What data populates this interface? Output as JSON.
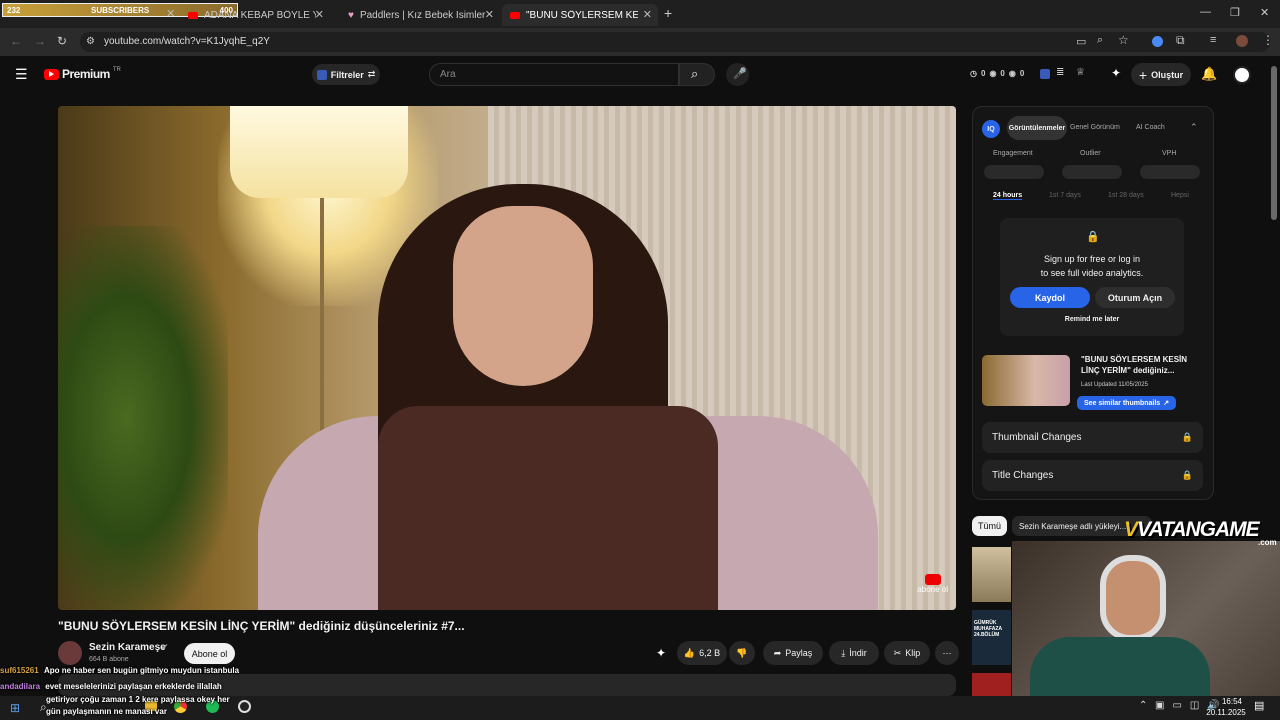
{
  "overlay": {
    "count": "232",
    "label": "SUBSCRIBERS",
    "count2": "400"
  },
  "tabs": [
    {
      "label": "ADANA KEBAP BÖYLE YAPILIR (",
      "active": false
    },
    {
      "label": "Paddlers | Kız Bebek İsimleri: A",
      "active": false
    },
    {
      "label": "\"BUNU SÖYLERSEM KESİN LİNÇ",
      "active": true
    }
  ],
  "browser": {
    "url": "youtube.com/watch?v=K1JyqhE_q2Y"
  },
  "youtube": {
    "brand": "Premium",
    "region": "TR",
    "filters": "Filtreler",
    "search_placeholder": "Ara",
    "create": "Oluştur",
    "counts": [
      "0",
      "0",
      "0"
    ]
  },
  "video": {
    "title": "\"BUNU SÖYLERSEM KESİN LİNÇ YERİM\" dediğiniz düşünceleriniz #7...",
    "channel": "Sezin Karameşe",
    "subs": "664 B abone",
    "subscribe": "Abone ol",
    "likes": "6,2 B",
    "share": "Paylaş",
    "download": "İndir",
    "clip": "Klip",
    "watermark": "abone ol"
  },
  "panel": {
    "tabs": [
      "Görüntülenmeler",
      "Genel Görünüm",
      "AI Coach"
    ],
    "metrics": [
      "Engagement",
      "Outlier",
      "VPH"
    ],
    "ranges": [
      "24 hours",
      "1st 7 days",
      "1st 28 days",
      "Hepsi"
    ],
    "lock_line1": "Sign up for free or log in",
    "lock_line2": "to see full video analytics.",
    "signup": "Kaydol",
    "login": "Oturum Açın",
    "remind": "Remind me later",
    "card_title": "\"BUNU SÖYLERSEM KESİN LİNÇ YERİM\" dediğiniz...",
    "card_updated": "Last Updated 11/05/2025",
    "card_button": "See similar thumbnails",
    "rows": [
      "Thumbnail Changes",
      "Title Changes"
    ]
  },
  "chips": {
    "all": "Tümü",
    "channel": "Sezin Karameşe adlı yükleyi..."
  },
  "thumbs": [
    {
      "label": "GÜMRÜK MUHAFAZA 24.BÖLÜM"
    }
  ],
  "stream": {
    "brand": "VATANGAME",
    "domain": ".com"
  },
  "chat": [
    {
      "user": "suf615261",
      "msg": "Apo ne haber sen bugün gitmiyo muydun istanbula"
    },
    {
      "user": "andadilara",
      "msg": "evet meselelerinizi paylaşan erkeklerde illallah"
    },
    {
      "user": "",
      "msg": "getiriyor çoğu zaman 1 2 kere paylassa okey her"
    },
    {
      "user": "",
      "msg": "gün paylaşmanın ne manası var"
    }
  ],
  "taskbar": {
    "time": "16:54",
    "date": "20.11.2025"
  },
  "colors": {
    "accent": "#2864e8",
    "youtube_red": "#ff0000"
  }
}
